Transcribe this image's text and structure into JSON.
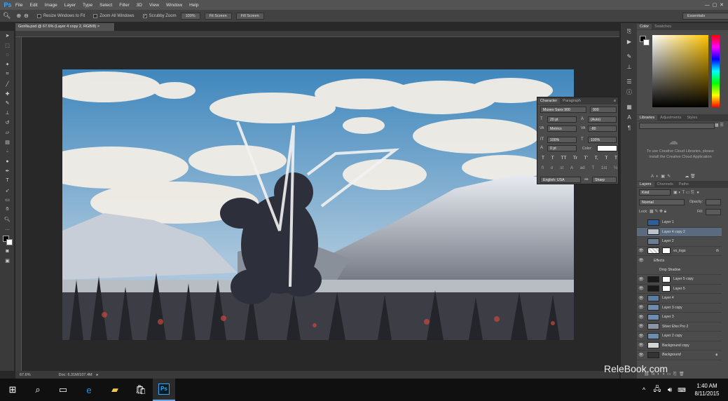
{
  "app": {
    "logo": "Ps",
    "accent": "#31a8ff"
  },
  "menu": [
    "File",
    "Edit",
    "Image",
    "Layer",
    "Type",
    "Select",
    "Filter",
    "3D",
    "View",
    "Window",
    "Help"
  ],
  "options": {
    "tool_icon": "zoom-icon",
    "resize_windows": "Resize Windows to Fit",
    "zoom_all": "Zoom All Windows",
    "scrubby": "Scrubby Zoom",
    "btn_100": "100%",
    "fit_screen": "Fit Screen",
    "fill_screen": "Fill Screen",
    "workspace": "Essentials"
  },
  "document": {
    "tab": "Gorilla.psd @ 67.6% (Layer 4 copy 2, RGB/8)",
    "zoom": "67.6%",
    "doc_size": "Doc: 6.31M/107.4M"
  },
  "character": {
    "tabs": [
      "Character",
      "Paragraph"
    ],
    "font_family": "Museo Sans 900",
    "font_style": "900",
    "size": "20 pt",
    "leading": "(Auto)",
    "kerning": "Metrics",
    "tracking": "-80",
    "vscale": "100%",
    "hscale": "100%",
    "baseline": "0 pt",
    "color_label": "Color:",
    "type_buttons": [
      "T",
      "T",
      "TT",
      "Tr",
      "T'",
      "T,",
      "T",
      "T"
    ],
    "ot_buttons": [
      "fi",
      "σ",
      "st",
      "A",
      "ad",
      "T",
      "1st",
      "½"
    ],
    "language": "English: USA",
    "antialias": "Sharp",
    "color": "#ffffff"
  },
  "color_panel": {
    "tabs": [
      "Color",
      "Swatches"
    ]
  },
  "libraries": {
    "tabs": [
      "Libraries",
      "Adjustments",
      "Styles"
    ],
    "message": "To use Creative Cloud Libraries, please install the Creative Cloud Application"
  },
  "layers_panel": {
    "tabs": [
      "Layers",
      "Channels",
      "Paths"
    ],
    "filter": "Kind",
    "blend": "Normal",
    "opacity_label": "Opacity:",
    "lock_label": "Lock:",
    "fill_label": "Fill:",
    "layers": [
      {
        "name": "Layer 1",
        "visible": false,
        "selected": false
      },
      {
        "name": "Layer 4 copy 2",
        "visible": false,
        "selected": true
      },
      {
        "name": "Layer 2",
        "visible": false,
        "selected": false
      },
      {
        "name": "vo_logo",
        "visible": true,
        "selected": false,
        "fx": "fx"
      },
      {
        "name": "Effects",
        "visible": true,
        "selected": false,
        "sub": true
      },
      {
        "name": "Drop Shadow",
        "visible": true,
        "selected": false,
        "sub": true
      },
      {
        "name": "Layer 5 copy",
        "visible": true,
        "selected": false
      },
      {
        "name": "Layer 5",
        "visible": true,
        "selected": false
      },
      {
        "name": "Layer 4",
        "visible": true,
        "selected": false
      },
      {
        "name": "Layer 3 copy",
        "visible": true,
        "selected": false
      },
      {
        "name": "Layer 3",
        "visible": true,
        "selected": false
      },
      {
        "name": "Silver Efex Pro 2",
        "visible": true,
        "selected": false
      },
      {
        "name": "Layer 2 copy",
        "visible": true,
        "selected": false
      },
      {
        "name": "Background copy",
        "visible": true,
        "selected": false
      },
      {
        "name": "Background",
        "visible": true,
        "selected": false,
        "italic": true
      }
    ]
  },
  "taskbar": {
    "time": "1:40 AM",
    "date": "8/11/2015",
    "ps_label": "Ps"
  },
  "watermark": "ReleBook.com"
}
